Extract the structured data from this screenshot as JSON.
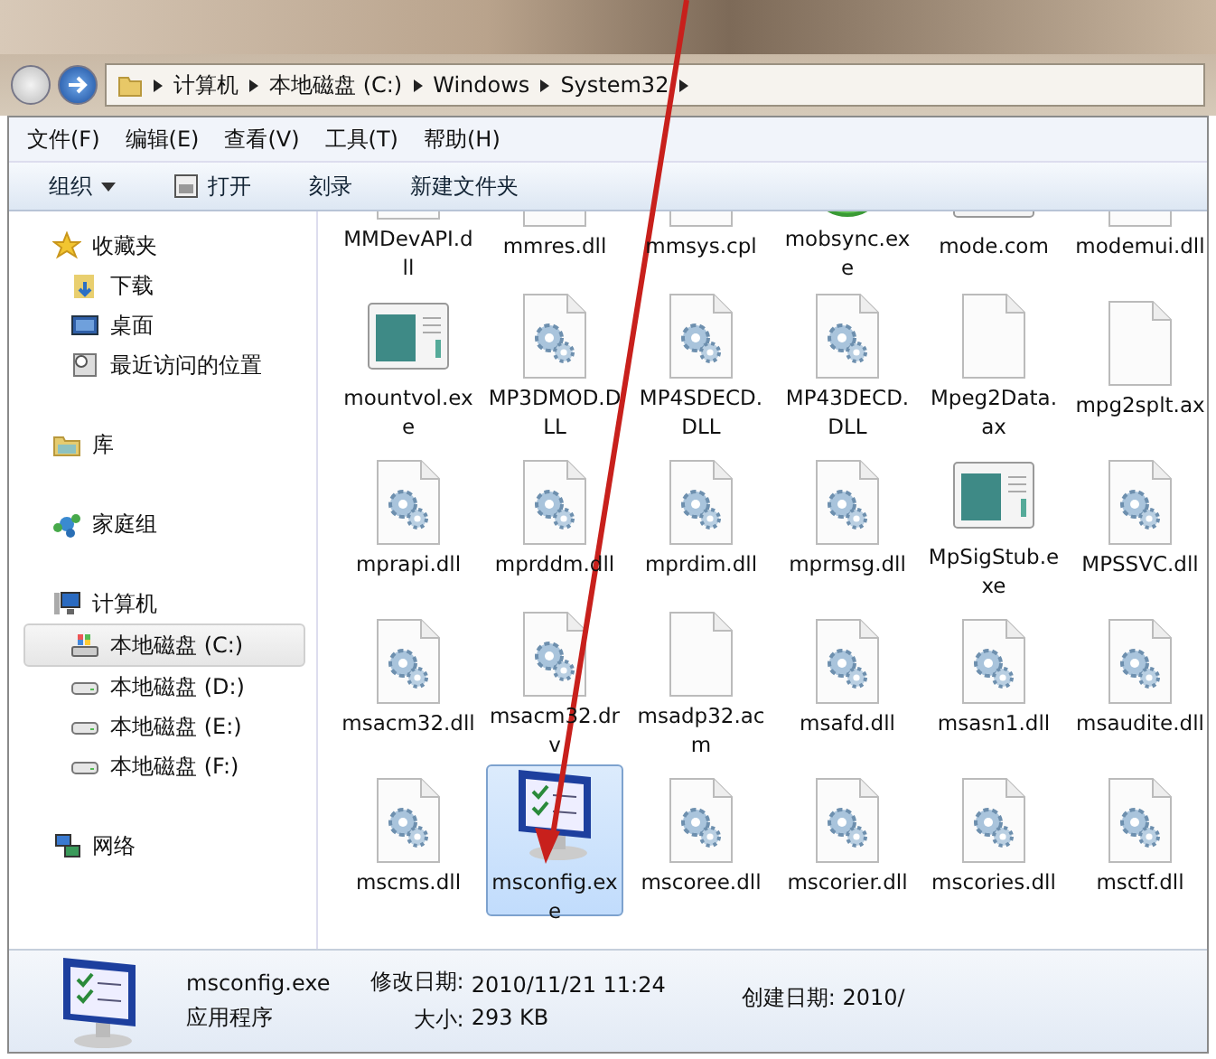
{
  "address_bar": {
    "path": [
      "计算机",
      "本地磁盘 (C:)",
      "Windows",
      "System32"
    ]
  },
  "menu_bar": [
    "文件(F)",
    "编辑(E)",
    "查看(V)",
    "工具(T)",
    "帮助(H)"
  ],
  "toolbar": [
    {
      "label": "组织",
      "kind": "dropdown"
    },
    {
      "label": "打开",
      "kind": "open"
    },
    {
      "label": "刻录",
      "kind": "plain"
    },
    {
      "label": "新建文件夹",
      "kind": "plain"
    }
  ],
  "sidebar": [
    {
      "label": "收藏夹",
      "kind": "star",
      "selected": false,
      "children": [
        {
          "label": "下载",
          "kind": "download",
          "selected": false
        },
        {
          "label": "桌面",
          "kind": "desktop",
          "selected": false
        },
        {
          "label": "最近访问的位置",
          "kind": "recent",
          "selected": false
        }
      ]
    },
    {
      "label": "库",
      "kind": "library",
      "selected": false
    },
    {
      "label": "家庭组",
      "kind": "homegroup",
      "selected": false
    },
    {
      "label": "计算机",
      "kind": "computer",
      "selected": false,
      "children": [
        {
          "label": "本地磁盘 (C:)",
          "kind": "sysdrive",
          "selected": true
        },
        {
          "label": "本地磁盘 (D:)",
          "kind": "drive",
          "selected": false
        },
        {
          "label": "本地磁盘 (E:)",
          "kind": "drive",
          "selected": false
        },
        {
          "label": "本地磁盘 (F:)",
          "kind": "drive",
          "selected": false
        }
      ]
    },
    {
      "label": "网络",
      "kind": "network",
      "selected": false
    }
  ],
  "files": [
    {
      "name": "MMDevAPI.dll",
      "kind": "gear",
      "selected": false
    },
    {
      "name": "mmres.dll",
      "kind": "gear",
      "selected": false
    },
    {
      "name": "mmsys.cpl",
      "kind": "gear",
      "selected": false
    },
    {
      "name": "mobsync.exe",
      "kind": "sync",
      "selected": false
    },
    {
      "name": "mode.com",
      "kind": "app",
      "selected": false
    },
    {
      "name": "modemui.dll",
      "kind": "gear",
      "selected": false
    },
    {
      "name": "mountvol.exe",
      "kind": "app",
      "selected": false
    },
    {
      "name": "MP3DMOD.DLL",
      "kind": "gear",
      "selected": false
    },
    {
      "name": "MP4SDECD.DLL",
      "kind": "gear",
      "selected": false
    },
    {
      "name": "MP43DECD.DLL",
      "kind": "gear",
      "selected": false
    },
    {
      "name": "Mpeg2Data.ax",
      "kind": "blank",
      "selected": false
    },
    {
      "name": "mpg2splt.ax",
      "kind": "blank",
      "selected": false
    },
    {
      "name": "mprapi.dll",
      "kind": "gear",
      "selected": false
    },
    {
      "name": "mprddm.dll",
      "kind": "gear",
      "selected": false
    },
    {
      "name": "mprdim.dll",
      "kind": "gear",
      "selected": false
    },
    {
      "name": "mprmsg.dll",
      "kind": "gear",
      "selected": false
    },
    {
      "name": "MpSigStub.exe",
      "kind": "app",
      "selected": false
    },
    {
      "name": "MPSSVC.dll",
      "kind": "gear",
      "selected": false
    },
    {
      "name": "msacm32.dll",
      "kind": "gear",
      "selected": false
    },
    {
      "name": "msacm32.drv",
      "kind": "gear",
      "selected": false
    },
    {
      "name": "msadp32.acm",
      "kind": "blank",
      "selected": false
    },
    {
      "name": "msafd.dll",
      "kind": "gear",
      "selected": false
    },
    {
      "name": "msasn1.dll",
      "kind": "gear",
      "selected": false
    },
    {
      "name": "msaudite.dll",
      "kind": "gear",
      "selected": false
    },
    {
      "name": "mscms.dll",
      "kind": "gear",
      "selected": false
    },
    {
      "name": "msconfig.exe",
      "kind": "msconfig",
      "selected": true
    },
    {
      "name": "mscoree.dll",
      "kind": "gear",
      "selected": false
    },
    {
      "name": "mscorier.dll",
      "kind": "gear",
      "selected": false
    },
    {
      "name": "mscories.dll",
      "kind": "gear",
      "selected": false
    },
    {
      "name": "msctf.dll",
      "kind": "gear",
      "selected": false
    }
  ],
  "details_pane": {
    "name": "msconfig.exe",
    "type": "应用程序",
    "fields": [
      {
        "label": "修改日期:",
        "value": "2010/11/21 11:24"
      },
      {
        "label": "大小:",
        "value": "293 KB"
      },
      {
        "label": "创建日期:",
        "value": "2010/"
      }
    ]
  }
}
